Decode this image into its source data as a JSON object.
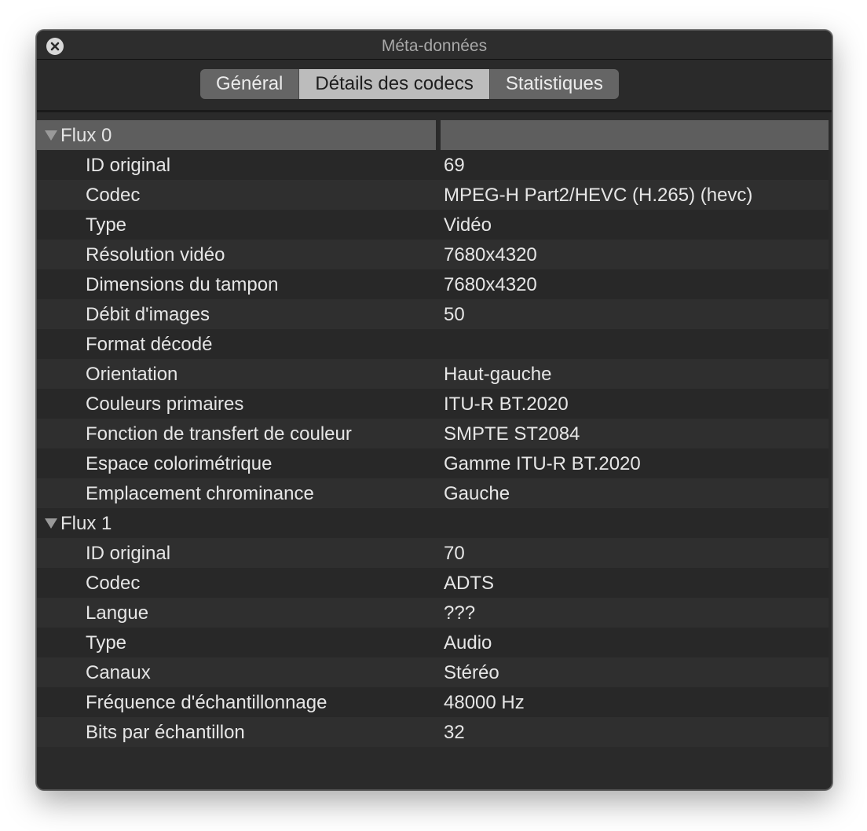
{
  "window": {
    "title": "Méta-données"
  },
  "tabs": [
    {
      "label": "Général"
    },
    {
      "label": "Détails des codecs"
    },
    {
      "label": "Statistiques"
    }
  ],
  "active_tab": "Détails des codecs",
  "streams": [
    {
      "label": "Flux 0",
      "rows": [
        {
          "key": "ID original",
          "value": "69"
        },
        {
          "key": "Codec",
          "value": "MPEG-H Part2/HEVC (H.265) (hevc)"
        },
        {
          "key": "Type",
          "value": "Vidéo"
        },
        {
          "key": "Résolution vidéo",
          "value": "7680x4320"
        },
        {
          "key": "Dimensions du tampon",
          "value": "7680x4320"
        },
        {
          "key": "Débit d'images",
          "value": "50"
        },
        {
          "key": "Format décodé",
          "value": ""
        },
        {
          "key": "Orientation",
          "value": "Haut-gauche"
        },
        {
          "key": "Couleurs primaires",
          "value": "ITU-R BT.2020"
        },
        {
          "key": "Fonction de transfert de couleur",
          "value": "SMPTE ST2084"
        },
        {
          "key": "Espace colorimétrique",
          "value": "Gamme ITU-R BT.2020"
        },
        {
          "key": "Emplacement chrominance",
          "value": "Gauche"
        }
      ]
    },
    {
      "label": "Flux 1",
      "rows": [
        {
          "key": "ID original",
          "value": "70"
        },
        {
          "key": "Codec",
          "value": "ADTS"
        },
        {
          "key": "Langue",
          "value": "???"
        },
        {
          "key": "Type",
          "value": "Audio"
        },
        {
          "key": "Canaux",
          "value": "Stéréo"
        },
        {
          "key": "Fréquence d'échantillonnage",
          "value": "48000 Hz"
        },
        {
          "key": "Bits par échantillon",
          "value": "32"
        }
      ]
    }
  ],
  "colors": {
    "window_bg": "#2a2a2a",
    "tab_active_bg": "#bcbcbc",
    "tab_bg": "#656565",
    "selected_row_bg": "#5e5e5e",
    "text": "#e6e6e6"
  }
}
